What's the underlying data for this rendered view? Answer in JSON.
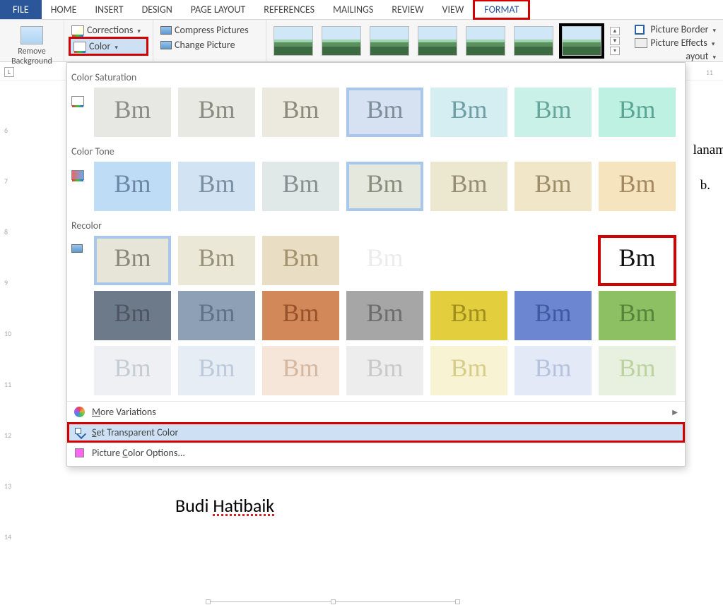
{
  "tabs": {
    "file": "FILE",
    "items": [
      "HOME",
      "INSERT",
      "DESIGN",
      "PAGE LAYOUT",
      "REFERENCES",
      "MAILINGS",
      "REVIEW",
      "VIEW",
      "FORMAT"
    ]
  },
  "ribbon": {
    "remove_bg_line1": "Remove",
    "remove_bg_line2": "Background",
    "corrections": "Corrections",
    "color": "Color",
    "compress": "Compress Pictures",
    "change": "Change Picture",
    "border": "Picture Border",
    "effects": "Picture Effects",
    "layout": "ayout"
  },
  "dropdown": {
    "section_sat": "Color Saturation",
    "section_tone": "Color Tone",
    "section_recolor": "Recolor",
    "more": "More Variations",
    "more_u": "M",
    "transparent_pre": "S",
    "transparent": "et Transparent Color",
    "options_pre": "Picture ",
    "options_u": "C",
    "options_post": "olor Options..."
  },
  "document": {
    "right1": "lanam",
    "right2": "b.",
    "signer": "Budi Hatibaik",
    "signer_first": "Budi ",
    "signer_last": "Hatibaik"
  },
  "ruler": {
    "h": [
      "11"
    ],
    "v": [
      "6",
      "7",
      "8",
      "9",
      "10",
      "11",
      "12",
      "13",
      "14"
    ]
  },
  "swatches": {
    "saturation": [
      {
        "bg": "#e7e7e3",
        "fg": "#8d8d87"
      },
      {
        "bg": "#e9e9e3",
        "fg": "#8a8b82"
      },
      {
        "bg": "#eceade",
        "fg": "#8b8b7d"
      },
      {
        "bg": "#d6e2f1",
        "fg": "#7e8f9a",
        "selected": true
      },
      {
        "bg": "#d4eef2",
        "fg": "#6f9ea7"
      },
      {
        "bg": "#caf1e7",
        "fg": "#66a69c"
      },
      {
        "bg": "#bef1e1",
        "fg": "#5aa690"
      }
    ],
    "tone": [
      {
        "bg": "#bfdcf6",
        "fg": "#6b88a5"
      },
      {
        "bg": "#d2e4f3",
        "fg": "#7b8fa2"
      },
      {
        "bg": "#e0e8e8",
        "fg": "#85908f"
      },
      {
        "bg": "#e5e8dc",
        "fg": "#8a8d7d",
        "selected": true
      },
      {
        "bg": "#ece8d0",
        "fg": "#938e73"
      },
      {
        "bg": "#f1e6c7",
        "fg": "#9c8c6a"
      },
      {
        "bg": "#f6e4be",
        "fg": "#a48960"
      }
    ],
    "recolor": [
      [
        {
          "bg": "#e7e5d8",
          "fg": "#8a887a",
          "selected": true
        },
        {
          "bg": "#ece8d8",
          "fg": "#97907b"
        },
        {
          "bg": "#e9ddc3",
          "fg": "#a3926e"
        },
        {
          "bg": "#ffffff",
          "fg": "#ececec"
        },
        {
          "bg": "#ffffff",
          "fg": "#ffffff"
        },
        {
          "bg": "#ffffff",
          "fg": "#ffffff"
        },
        {
          "bg": "#ffffff",
          "fg": "#111111",
          "highlight": true
        }
      ],
      [
        {
          "bg": "#6d7a8a",
          "fg": "#4a5662"
        },
        {
          "bg": "#8ea0b6",
          "fg": "#5e7289"
        },
        {
          "bg": "#d28858",
          "fg": "#96532b"
        },
        {
          "bg": "#a6a6a6",
          "fg": "#6d6d6d"
        },
        {
          "bg": "#e3cf3e",
          "fg": "#a08f1e"
        },
        {
          "bg": "#6d86d1",
          "fg": "#3f5aa3"
        },
        {
          "bg": "#8cc063",
          "fg": "#56843a"
        }
      ],
      [
        {
          "bg": "#eef0f3",
          "fg": "#c5ccd4"
        },
        {
          "bg": "#e6edf5",
          "fg": "#bccadb"
        },
        {
          "bg": "#f6e5d9",
          "fg": "#d6b79f"
        },
        {
          "bg": "#ededed",
          "fg": "#c9c9c9"
        },
        {
          "bg": "#f8f3d3",
          "fg": "#d7cd8b"
        },
        {
          "bg": "#e3e9f6",
          "fg": "#b6c3de"
        },
        {
          "bg": "#e8f1df",
          "fg": "#bcd29f"
        }
      ]
    ]
  }
}
